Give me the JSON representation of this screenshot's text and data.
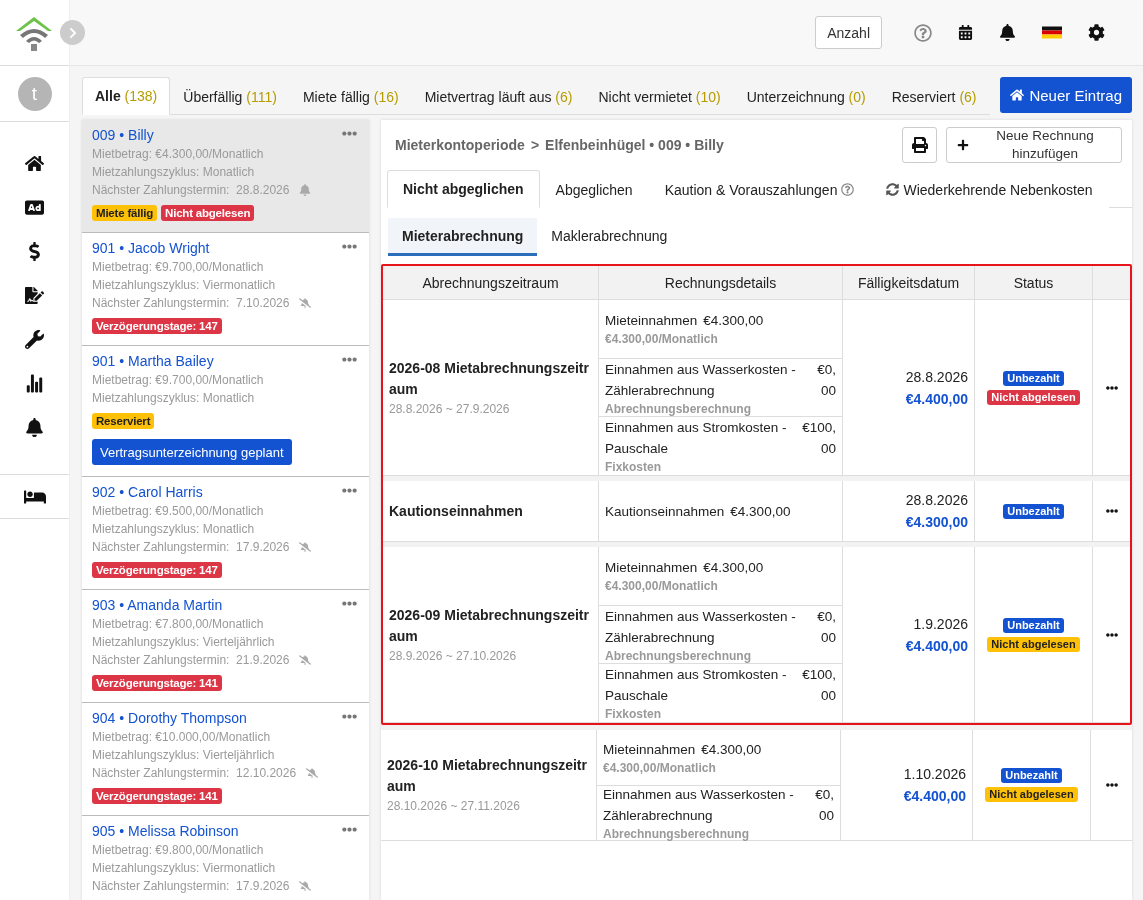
{
  "sidebar": {
    "avatar": "t"
  },
  "topbar": {
    "count_button": "Anzahl"
  },
  "filters": {
    "tabs": [
      {
        "label": "Alle",
        "count": "(138)",
        "selected": true
      },
      {
        "label": "Überfällig",
        "count": "(111)",
        "selected": false
      },
      {
        "label": "Miete fällig",
        "count": "(16)",
        "selected": false
      },
      {
        "label": "Mietvertrag läuft aus",
        "count": "(6)",
        "selected": false
      },
      {
        "label": "Nicht vermietet",
        "count": "(10)",
        "selected": false
      },
      {
        "label": "Unterzeichnung",
        "count": "(0)",
        "selected": false
      },
      {
        "label": "Reserviert",
        "count": "(6)",
        "selected": false
      }
    ],
    "new_button": "Neuer Eintrag"
  },
  "tenants": [
    {
      "unit": "009",
      "separator": "•",
      "name": "Billy",
      "selected": true,
      "rent": "Mietbetrag: €4.300,00/Monatlich",
      "cycle": "Mietzahlungszyklus: Monatlich",
      "next_payment": "Nächster Zahlungstermin:  28.8.2026",
      "reminder": true,
      "tags": [
        {
          "label": "Miete fällig",
          "color": "#ffc107"
        },
        {
          "label": "Nicht abgelesen",
          "color": "#dc3545"
        }
      ]
    },
    {
      "unit": "901",
      "separator": "•",
      "name": "Jacob Wright",
      "selected": false,
      "rent": "Mietbetrag: €9.700,00/Monatlich",
      "cycle": "Mietzahlungszyklus: Viermonatlich",
      "next_payment": "Nächster Zahlungstermin:  7.10.2026",
      "reminder": false,
      "tags": [
        {
          "label": "Verzögerungstage: 147",
          "color": "#dc3545"
        }
      ]
    },
    {
      "unit": "901",
      "separator": "•",
      "name": "Martha Bailey",
      "selected": false,
      "rent": "Mietbetrag: €9.700,00/Monatlich",
      "cycle": "Mietzahlungszyklus: Monatlich",
      "tags": [
        {
          "label": "Reserviert",
          "color": "#ffc107"
        }
      ],
      "action": "Vertragsunterzeichnung geplant"
    },
    {
      "unit": "902",
      "separator": "•",
      "name": "Carol Harris",
      "selected": false,
      "rent": "Mietbetrag: €9.500,00/Monatlich",
      "cycle": "Mietzahlungszyklus: Monatlich",
      "next_payment": "Nächster Zahlungstermin:  17.9.2026",
      "reminder": false,
      "tags": [
        {
          "label": "Verzögerungstage: 147",
          "color": "#dc3545"
        }
      ]
    },
    {
      "unit": "903",
      "separator": "•",
      "name": "Amanda Martin",
      "selected": false,
      "rent": "Mietbetrag: €7.800,00/Monatlich",
      "cycle": "Mietzahlungszyklus: Vierteljährlich",
      "next_payment": "Nächster Zahlungstermin:  21.9.2026",
      "reminder": false,
      "tags": [
        {
          "label": "Verzögerungstage: 141",
          "color": "#dc3545"
        }
      ]
    },
    {
      "unit": "904",
      "separator": "•",
      "name": "Dorothy Thompson",
      "selected": false,
      "rent": "Mietbetrag: €10.000,00/Monatlich",
      "cycle": "Mietzahlungszyklus: Vierteljährlich",
      "next_payment": "Nächster Zahlungstermin:  12.10.2026",
      "reminder": false,
      "tags": [
        {
          "label": "Verzögerungstage: 141",
          "color": "#dc3545"
        }
      ]
    },
    {
      "unit": "905",
      "separator": "•",
      "name": "Melissa Robinson",
      "selected": false,
      "rent": "Mietbetrag: €9.800,00/Monatlich",
      "cycle": "Mietzahlungszyklus: Viermonatlich",
      "next_payment": "Nächster Zahlungstermin:  17.9.2026",
      "reminder": false
    }
  ],
  "detail": {
    "breadcrumb": {
      "items": [
        "Mieterkontoperiode",
        "Elfenbeinhügel • 009 • Billy"
      ],
      "separator": ">"
    },
    "add_invoice": "Neue Rechnung hinzufügen",
    "tabs": [
      {
        "label": "Nicht abgeglichen",
        "kind": "plain",
        "selected": true
      },
      {
        "label": "Abgeglichen",
        "kind": "plain",
        "selected": false
      },
      {
        "label": "Kaution & Vorauszahlungen",
        "kind": "help",
        "selected": false
      },
      {
        "label": "Wiederkehrende Nebenkosten",
        "kind": "recurring",
        "selected": false
      }
    ],
    "subtabs": [
      {
        "label": "Mieterabrechnung",
        "selected": true
      },
      {
        "label": "Maklerabrechnung",
        "selected": false
      }
    ],
    "table": {
      "columns": [
        "Abrechnungszeitraum",
        "Rechnungsdetails",
        "Fälligkeitsdatum",
        "Status"
      ],
      "groups": [
        {
          "highlighted": true,
          "title": "2026-08 Mietabrechnungszeitraum",
          "range": "28.8.2026 ~ 27.9.2026",
          "items": [
            {
              "kind": "inline",
              "name": "Mieteinnahmen",
              "amount": "€4.300,00",
              "note": "€4.300,00/Monatlich"
            },
            {
              "kind": "split",
              "name": "Einnahmen aus Wasserkosten - Zählerabrechnung",
              "amount": "€0,00",
              "note": "Abrechnungsberechnung"
            },
            {
              "kind": "split",
              "name": "Einnahmen aus Stromkosten - Pauschale",
              "amount": "€100,00",
              "note": "Fixkosten"
            }
          ],
          "due_date": "28.8.2026",
          "total": "€4.400,00",
          "badges": [
            {
              "label": "Unbezahlt",
              "color": "#1352d0"
            },
            {
              "label": "Nicht abgelesen",
              "color": "#dc3545"
            }
          ]
        },
        {
          "highlighted": true,
          "title": "Kautionseinnahmen",
          "items": [
            {
              "kind": "inline",
              "name": "Kautionseinnahmen",
              "amount": "€4.300,00"
            }
          ],
          "due_date": "28.8.2026",
          "total": "€4.300,00",
          "badges": [
            {
              "label": "Unbezahlt",
              "color": "#1352d0"
            }
          ]
        },
        {
          "highlighted": true,
          "title": "2026-09 Mietabrechnungszeitraum",
          "range": "28.9.2026 ~ 27.10.2026",
          "items": [
            {
              "kind": "inline",
              "name": "Mieteinnahmen",
              "amount": "€4.300,00",
              "note": "€4.300,00/Monatlich"
            },
            {
              "kind": "split",
              "name": "Einnahmen aus Wasserkosten - Zählerabrechnung",
              "amount": "€0,00",
              "note": "Abrechnungsberechnung"
            },
            {
              "kind": "split",
              "name": "Einnahmen aus Stromkosten - Pauschale",
              "amount": "€100,00",
              "note": "Fixkosten"
            }
          ],
          "due_date": "1.9.2026",
          "total": "€4.400,00",
          "badges": [
            {
              "label": "Unbezahlt",
              "color": "#1352d0"
            },
            {
              "label": "Nicht abgelesen",
              "color": "#ffc107"
            }
          ]
        },
        {
          "highlighted": false,
          "title": "2026-10 Mietabrechnungszeitraum",
          "range": "28.10.2026 ~ 27.11.2026",
          "items": [
            {
              "kind": "inline",
              "name": "Mieteinnahmen",
              "amount": "€4.300,00",
              "note": "€4.300,00/Monatlich"
            },
            {
              "kind": "split",
              "name": "Einnahmen aus Wasserkosten - Zählerabrechnung",
              "amount": "€0,00",
              "note": "Abrechnungsberechnung"
            }
          ],
          "due_date": "1.10.2026",
          "total": "€4.400,00",
          "badges": [
            {
              "label": "Unbezahlt",
              "color": "#1352d0"
            },
            {
              "label": "Nicht abgelesen",
              "color": "#ffc107"
            }
          ]
        }
      ]
    }
  }
}
